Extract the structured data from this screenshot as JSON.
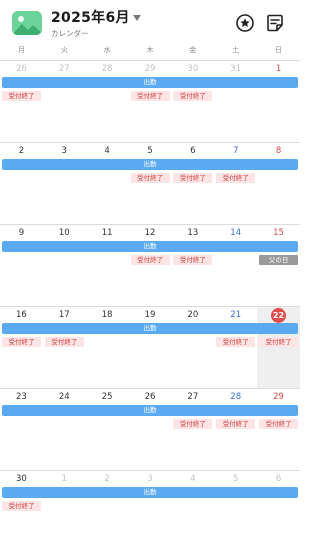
{
  "header": {
    "title": "2025年6月",
    "subtitle": "カレンダー",
    "icons": {
      "app": "calendar-app-icon",
      "favorite": "star-circle-icon",
      "notes": "notes-icon"
    }
  },
  "weekdays": [
    "月",
    "火",
    "水",
    "木",
    "金",
    "土",
    "日"
  ],
  "shift_label": "出勤",
  "tag_label": "受付終了",
  "holiday_label": "父の日",
  "colors": {
    "shift": "#5aaaf2",
    "tag_bg": "#fde5e5",
    "tag_text": "#d53b3b",
    "saturday": "#3b6fd6",
    "sunday": "#d14a4a",
    "today": "#e14d4d",
    "holiday_bg": "#9a9a9a"
  },
  "weeks": [
    {
      "days": [
        "26",
        "27",
        "28",
        "29",
        "30",
        "31",
        "1"
      ],
      "other": [
        0,
        1,
        2,
        3,
        4,
        5
      ],
      "tags": [
        0,
        3,
        4
      ]
    },
    {
      "days": [
        "2",
        "3",
        "4",
        "5",
        "6",
        "7",
        "8"
      ],
      "other": [],
      "tags": [
        3,
        4,
        5
      ]
    },
    {
      "days": [
        "9",
        "10",
        "11",
        "12",
        "13",
        "14",
        "15"
      ],
      "other": [],
      "tags": [
        3,
        4
      ],
      "holiday_col": 6
    },
    {
      "days": [
        "16",
        "17",
        "18",
        "19",
        "20",
        "21",
        "22"
      ],
      "other": [],
      "tags": [
        0,
        1,
        5,
        6
      ],
      "today_col": 6
    },
    {
      "days": [
        "23",
        "24",
        "25",
        "26",
        "27",
        "28",
        "29"
      ],
      "other": [],
      "tags": [
        4,
        5,
        6
      ]
    },
    {
      "days": [
        "30",
        "1",
        "2",
        "3",
        "4",
        "5",
        "6"
      ],
      "other": [
        1,
        2,
        3,
        4,
        5,
        6
      ],
      "tags": [
        0
      ]
    }
  ]
}
